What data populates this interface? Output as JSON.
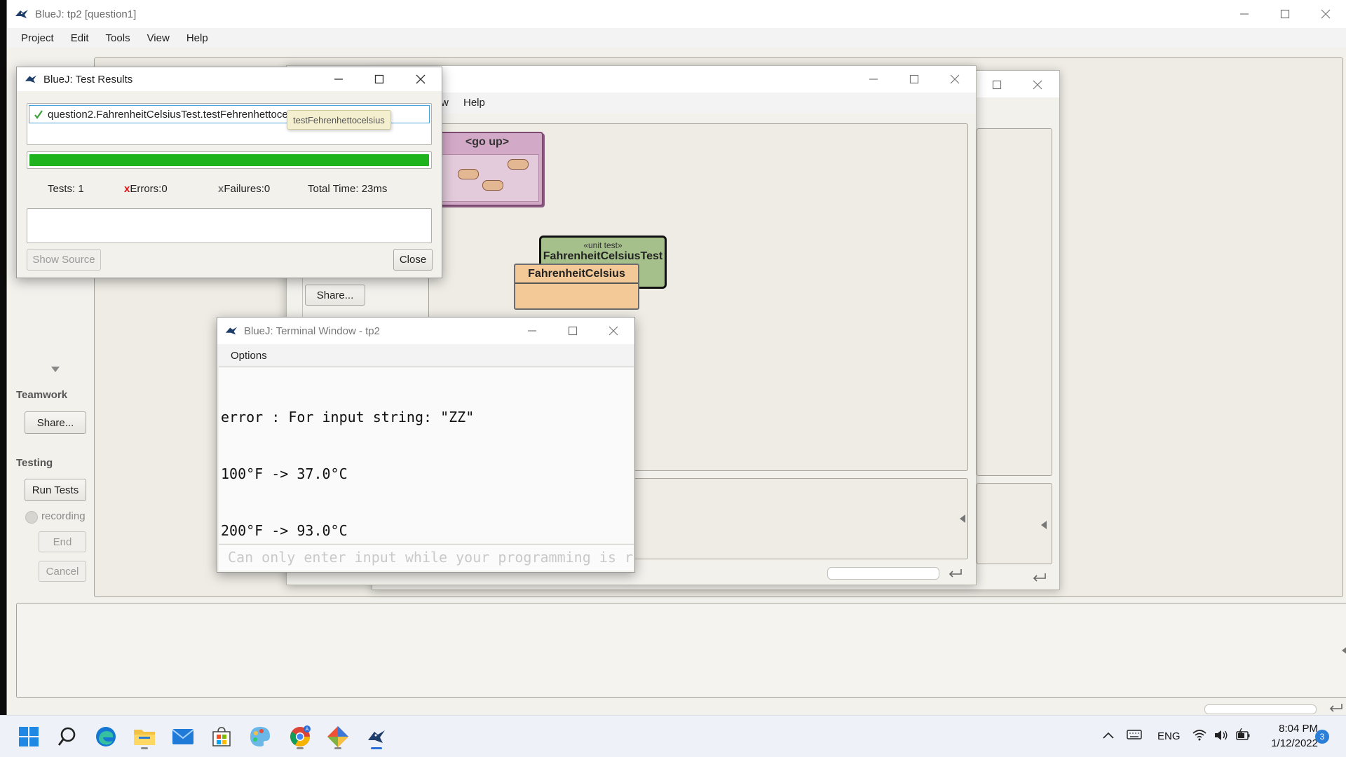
{
  "main_window": {
    "title": "BlueJ:  tp2  [question1]",
    "menu": [
      "Project",
      "Edit",
      "Tools",
      "View",
      "Help"
    ]
  },
  "side_panel": {
    "teamwork_label": "Teamwork",
    "share_button": "Share...",
    "testing_label": "Testing",
    "run_tests_button": "Run Tests",
    "recording_label": "recording",
    "end_button": "End",
    "cancel_button": "Cancel"
  },
  "package_window": {
    "menu_fragment": "w",
    "help_menu": "Help",
    "share_button": "Share...",
    "go_up_label": "<go up>",
    "unit_test_stereotype": "«unit test»",
    "unit_test_name": "FahrenheitCelsiusTest",
    "class_name": "FahrenheitCelsius"
  },
  "test_results": {
    "title": "BlueJ:  Test Results",
    "test_entry": "question2.FahrenheitCelsiusTest.testFehrenhettocelsius()",
    "tooltip": "testFehrenhettocelsius",
    "progress": 1.0,
    "progress_color": "#1fb41e",
    "tests_label": "Tests:  1",
    "errors_label": "Errors:0",
    "failures_label": "Failures:0",
    "total_time_label": "Total Time:  23ms",
    "show_source_button": "Show Source",
    "close_button": "Close"
  },
  "terminal": {
    "title": "BlueJ: Terminal Window - tp2",
    "options_menu": "Options",
    "output_lines": [
      "error : For input string: \"ZZ\"",
      "100°F -> 37.0°C",
      "200°F -> 93.0°C"
    ],
    "input_placeholder": "Can only enter input while your programming is running"
  },
  "taskbar": {
    "apps": [
      "start-icon",
      "search-icon",
      "edge-icon",
      "file-explorer-icon",
      "mail-icon",
      "store-icon",
      "paint-icon",
      "chrome-icon",
      "git-icon",
      "bluej-icon"
    ],
    "language": "ENG",
    "time": "8:04 PM",
    "date": "1/12/2022",
    "notification_count": "3"
  }
}
